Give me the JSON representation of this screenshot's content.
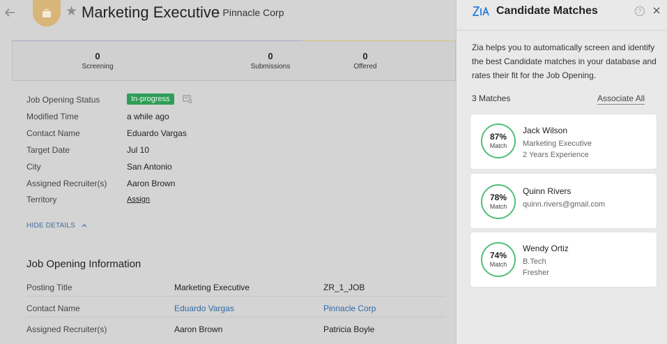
{
  "header": {
    "job_title": "Marketing Executive",
    "company": "- Pinnacle Corp"
  },
  "stats": [
    {
      "count": "0",
      "label": "Screening"
    },
    {
      "count": "0",
      "label": "Submissions"
    },
    {
      "count": "0",
      "label": "Offered"
    }
  ],
  "details": {
    "status_label": "Job Opening Status",
    "status_value": "In-progress",
    "modified_label": "Modified Time",
    "modified_value": "a while ago",
    "contact_label": "Contact Name",
    "contact_value": "Eduardo Vargas",
    "target_label": "Target Date",
    "target_value": "Jul 10",
    "city_label": "City",
    "city_value": "San Antonio",
    "recruiter_label": "Assigned Recruiter(s)",
    "recruiter_value": "Aaron Brown",
    "territory_label": "Territory",
    "territory_value": "Assign",
    "hide_details": "HIDE DETAILS"
  },
  "info": {
    "section_title": "Job Opening Information",
    "rows": [
      {
        "label": "Posting Title",
        "v1": "Marketing Executive",
        "v2": "ZR_1_JOB"
      },
      {
        "label": "Contact Name",
        "v1": "Eduardo Vargas",
        "v2": "Pinnacle Corp"
      },
      {
        "label": "Assigned Recruiter(s)",
        "v1": "Aaron Brown",
        "v2": "Patricia Boyle"
      }
    ]
  },
  "panel": {
    "title": "Candidate Matches",
    "help": "?",
    "description": "Zia helps you to automatically screen and identify the best Candidate matches in your database and rates their fit for the Job Opening.",
    "matches_count": "3 Matches",
    "associate_all": "Associate All",
    "candidates": [
      {
        "pct": "87%",
        "match_label": "Match",
        "name": "Jack Wilson",
        "line1": "Marketing Executive",
        "line2": "2 Years Experience"
      },
      {
        "pct": "78%",
        "match_label": "Match",
        "name": "Quinn Rivers",
        "line1": "quinn.rivers@gmail.com",
        "line2": ""
      },
      {
        "pct": "74%",
        "match_label": "Match",
        "name": "Wendy Ortiz",
        "line1": "B.Tech",
        "line2": "Fresher"
      }
    ]
  },
  "colors": {
    "match_ring": "#4fbf78",
    "status_green": "#2f9e58",
    "link_blue": "#2f6aa8",
    "zia_blue": "#2a7fd4"
  }
}
